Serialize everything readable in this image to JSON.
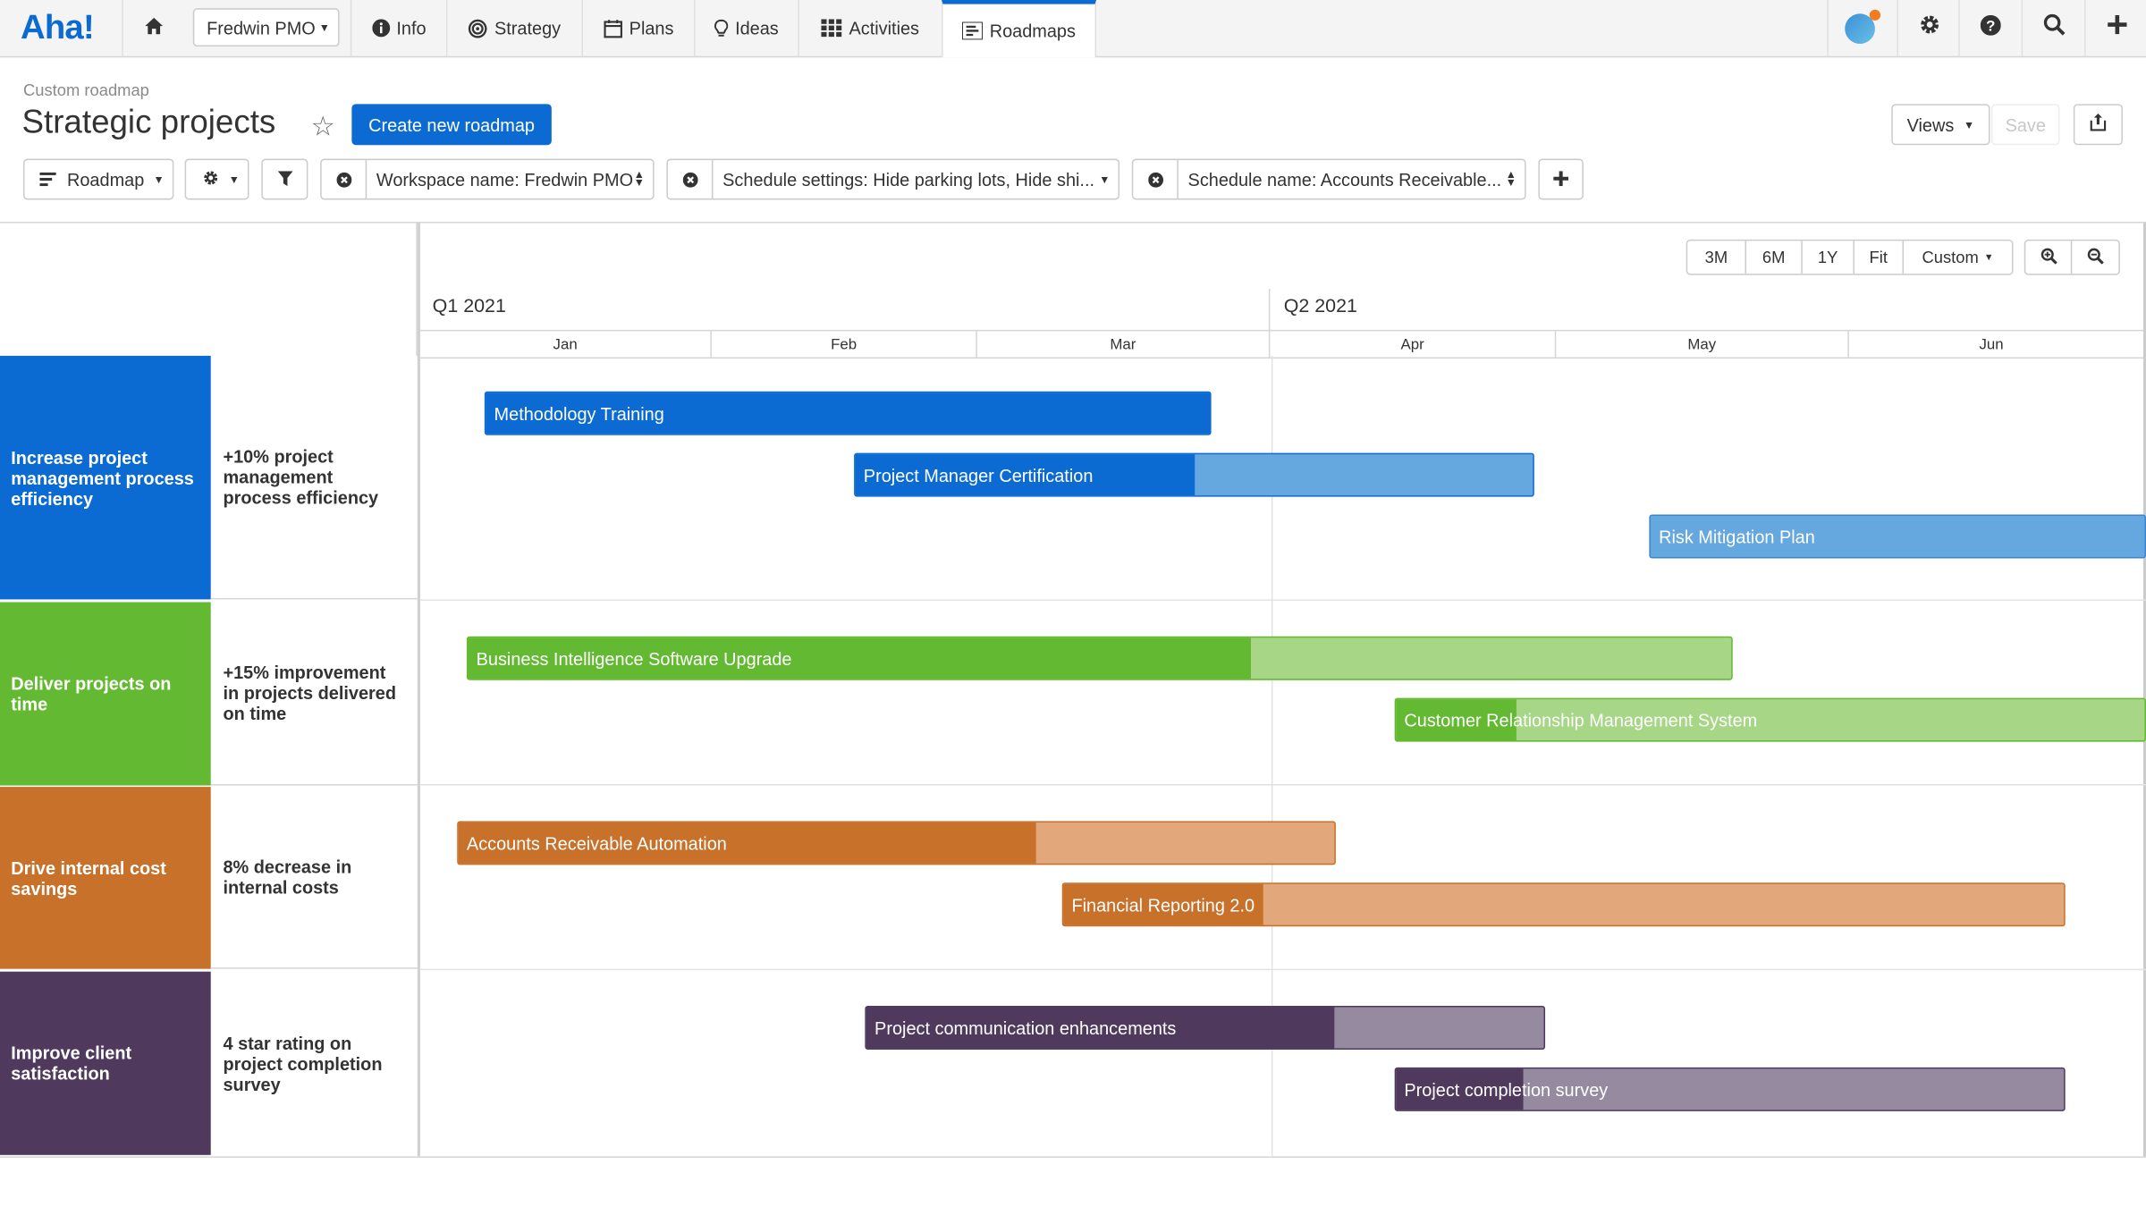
{
  "nav": {
    "logo": "Aha!",
    "workspace": "Fredwin PMO",
    "items": [
      {
        "label": "Info"
      },
      {
        "label": "Strategy"
      },
      {
        "label": "Plans"
      },
      {
        "label": "Ideas"
      },
      {
        "label": "Activities"
      },
      {
        "label": "Roadmaps"
      }
    ]
  },
  "header": {
    "breadcrumb": "Custom roadmap",
    "title": "Strategic projects",
    "create_button": "Create new roadmap",
    "views": "Views",
    "save": "Save"
  },
  "toolbar": {
    "view": "Roadmap",
    "filters": [
      "Workspace name: Fredwin PMO",
      "Schedule settings: Hide parking lots, Hide shi...",
      "Schedule name: Accounts Receivable..."
    ]
  },
  "timeline": {
    "zoom": [
      "3M",
      "6M",
      "1Y",
      "Fit",
      "Custom"
    ],
    "quarters": [
      "Q1 2021",
      "Q2 2021"
    ],
    "months": [
      "Jan",
      "Feb",
      "Mar",
      "Apr",
      "May",
      "Jun"
    ]
  },
  "colors": {
    "blue": "#0b6bd2",
    "blue_light": "#65a8e0",
    "green": "#63b932",
    "green_light": "#a6d686",
    "orange": "#c8712a",
    "orange_light": "#e2a87c",
    "purple": "#4f3a5e",
    "purple_light": "#968aa0"
  },
  "lanes": [
    {
      "goal": "Increase project management process efficiency",
      "initiative": "+10% project management process efficiency",
      "color": "#0b6bd2",
      "bars": [
        {
          "name": "Methodology Training",
          "progress": 1.0
        },
        {
          "name": "Project Manager Certification",
          "progress": 0.5
        },
        {
          "name": "Risk Mitigation Plan",
          "progress": 0.0
        }
      ]
    },
    {
      "goal": "Deliver projects on time",
      "initiative": "+15% improvement in projects delivered on time",
      "color": "#63b932",
      "bars": [
        {
          "name": "Business Intelligence Software Upgrade",
          "progress": 0.62
        },
        {
          "name": "Customer Relationship Management System",
          "progress": 0.16
        }
      ]
    },
    {
      "goal": "Drive internal cost savings",
      "initiative": "8% decrease in internal costs",
      "color": "#c8712a",
      "bars": [
        {
          "name": "Accounts Receivable Automation",
          "progress": 0.66
        },
        {
          "name": "Financial Reporting 2.0",
          "progress": 0.2
        }
      ]
    },
    {
      "goal": "Improve client satisfaction",
      "initiative": "4 star rating on project completion survey",
      "color": "#4f3a5e",
      "bars": [
        {
          "name": "Project communication enhancements",
          "progress": 0.69
        },
        {
          "name": "Project completion survey",
          "progress": 0.19
        }
      ]
    }
  ]
}
